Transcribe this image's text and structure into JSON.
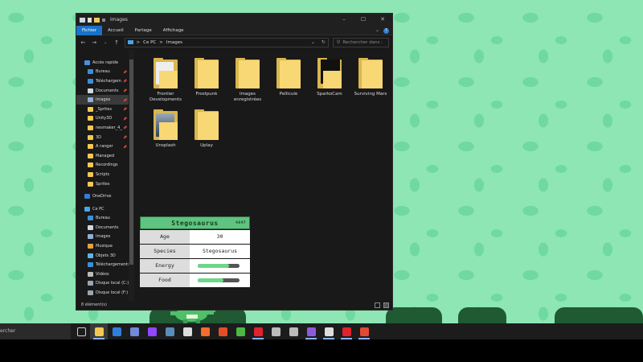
{
  "window": {
    "title": "Images",
    "controls": [
      "–",
      "☐",
      "✕"
    ]
  },
  "ribbon": {
    "tabs": [
      "Fichier",
      "Accueil",
      "Partage",
      "Affichage"
    ],
    "active_tab": "Fichier",
    "expand_glyph": "⌄",
    "help_glyph": "?"
  },
  "address": {
    "path": [
      "Ce PC",
      "Images"
    ],
    "separator": ">",
    "dropdown_glyph": "⌄",
    "refresh_glyph": "↻"
  },
  "search": {
    "placeholder": "Rechercher dans :"
  },
  "nav_pane": {
    "items": [
      {
        "label": "Accès rapide",
        "icon": "star-icon",
        "color": "#4a90e2",
        "level": 0,
        "pinned": false
      },
      {
        "label": "Bureau",
        "icon": "desktop-icon",
        "color": "#3b8fd8",
        "level": 1,
        "pinned": true
      },
      {
        "label": "Téléchargem",
        "icon": "download-icon",
        "color": "#3b8fd8",
        "level": 1,
        "pinned": true
      },
      {
        "label": "Documents",
        "icon": "document-icon",
        "color": "#cfd8e0",
        "level": 1,
        "pinned": true
      },
      {
        "label": "Images",
        "icon": "image-icon",
        "color": "#8fb0d6",
        "level": 1,
        "pinned": true,
        "selected": true
      },
      {
        "label": "_Sprites",
        "icon": "folder-icon",
        "color": "#f3c851",
        "level": 1,
        "pinned": true
      },
      {
        "label": "Unity3D",
        "icon": "folder-icon",
        "color": "#f3c851",
        "level": 1,
        "pinned": true
      },
      {
        "label": "nesmaker_4_",
        "icon": "folder-icon",
        "color": "#f3c851",
        "level": 1,
        "pinned": true
      },
      {
        "label": "3D",
        "icon": "folder-icon",
        "color": "#f3c851",
        "level": 1,
        "pinned": true
      },
      {
        "label": "A ranger",
        "icon": "folder-icon",
        "color": "#f3c851",
        "level": 1,
        "pinned": true
      },
      {
        "label": "Managed",
        "icon": "folder-icon",
        "color": "#f3c851",
        "level": 1,
        "pinned": false
      },
      {
        "label": "Recordings",
        "icon": "folder-icon",
        "color": "#f3c851",
        "level": 1,
        "pinned": false
      },
      {
        "label": "Scripts",
        "icon": "folder-icon",
        "color": "#f3c851",
        "level": 1,
        "pinned": false
      },
      {
        "label": "Sprites",
        "icon": "folder-icon",
        "color": "#f3c851",
        "level": 1,
        "pinned": false
      },
      {
        "label": "OneDrive",
        "icon": "cloud-icon",
        "color": "#2f7fd9",
        "level": 0,
        "pinned": false,
        "gap": true
      },
      {
        "label": "Ce PC",
        "icon": "pc-icon",
        "color": "#4aa3e8",
        "level": 0,
        "pinned": false,
        "gap": true
      },
      {
        "label": "Bureau",
        "icon": "desktop-icon",
        "color": "#3b8fd8",
        "level": 1,
        "pinned": false
      },
      {
        "label": "Documents",
        "icon": "document-icon",
        "color": "#cfd8e0",
        "level": 1,
        "pinned": false
      },
      {
        "label": "Images",
        "icon": "image-icon",
        "color": "#8fb0d6",
        "level": 1,
        "pinned": false
      },
      {
        "label": "Musique",
        "icon": "music-icon",
        "color": "#e8a13b",
        "level": 1,
        "pinned": false
      },
      {
        "label": "Objets 3D",
        "icon": "cube-icon",
        "color": "#5fb3e8",
        "level": 1,
        "pinned": false
      },
      {
        "label": "Téléchargements",
        "icon": "download-icon",
        "color": "#3b8fd8",
        "level": 1,
        "pinned": false
      },
      {
        "label": "Vidéos",
        "icon": "video-icon",
        "color": "#bbbbbb",
        "level": 1,
        "pinned": false
      },
      {
        "label": "Disque local (C:)",
        "icon": "drive-icon",
        "color": "#9aa6b2",
        "level": 1,
        "pinned": false
      },
      {
        "label": "Disque local (F:)",
        "icon": "drive-icon",
        "color": "#9aa6b2",
        "level": 1,
        "pinned": false
      }
    ]
  },
  "folders": [
    {
      "label": "Frontier Developments",
      "style": "paper"
    },
    {
      "label": "Frostpunk",
      "style": "plain"
    },
    {
      "label": "Images enregistrées",
      "style": "plain"
    },
    {
      "label": "Pellicule",
      "style": "plain"
    },
    {
      "label": "SparkoCam",
      "style": "dark"
    },
    {
      "label": "Surviving Mars",
      "style": "plain"
    },
    {
      "label": "Unsplash",
      "style": "photo"
    },
    {
      "label": "Uplay",
      "style": "plain"
    }
  ],
  "dino_card": {
    "name": "Stegosaurus",
    "id": "4847",
    "rows": [
      {
        "key": "Age",
        "value": "30"
      },
      {
        "key": "Species",
        "value": "Stegosaurus"
      },
      {
        "key": "Energy",
        "bar": 0.75
      },
      {
        "key": "Food",
        "bar": 0.62
      }
    ],
    "bar_color": "#6ed68a"
  },
  "statusbar": {
    "text": "8 élément(s)"
  },
  "taskbar": {
    "search_text": "ercher",
    "apps": [
      {
        "icon": "task-view-icon",
        "color": "#cccccc",
        "open": false
      },
      {
        "icon": "file-explorer-icon",
        "color": "#f3c851",
        "open": true,
        "active": true
      },
      {
        "icon": "edge-icon",
        "color": "#2f7fd9",
        "open": false
      },
      {
        "icon": "discord-icon",
        "color": "#7289da",
        "open": false
      },
      {
        "icon": "twitch-icon",
        "color": "#9146ff",
        "open": false
      },
      {
        "icon": "steam-icon",
        "color": "#5a8dbd",
        "open": false
      },
      {
        "icon": "epic-games-icon",
        "color": "#dddddd",
        "open": false
      },
      {
        "icon": "origin-icon",
        "color": "#f56c2d",
        "open": false
      },
      {
        "icon": "html5-icon",
        "color": "#e44d26",
        "open": false
      },
      {
        "icon": "camtasia-icon",
        "color": "#4cb944",
        "open": false
      },
      {
        "icon": "opera-icon",
        "color": "#e0232f",
        "open": true
      },
      {
        "icon": "sketchup-icon",
        "color": "#bbbbbb",
        "open": false
      },
      {
        "icon": "copy-icon",
        "color": "#bbbbbb",
        "open": false
      },
      {
        "icon": "visual-studio-icon",
        "color": "#8e5bd8",
        "open": true
      },
      {
        "icon": "unity-icon",
        "color": "#dddddd",
        "open": true
      },
      {
        "icon": "game-app-icon",
        "color": "#e0232f",
        "open": true
      },
      {
        "icon": "red-app-icon",
        "color": "#e04a32",
        "open": true
      }
    ]
  }
}
